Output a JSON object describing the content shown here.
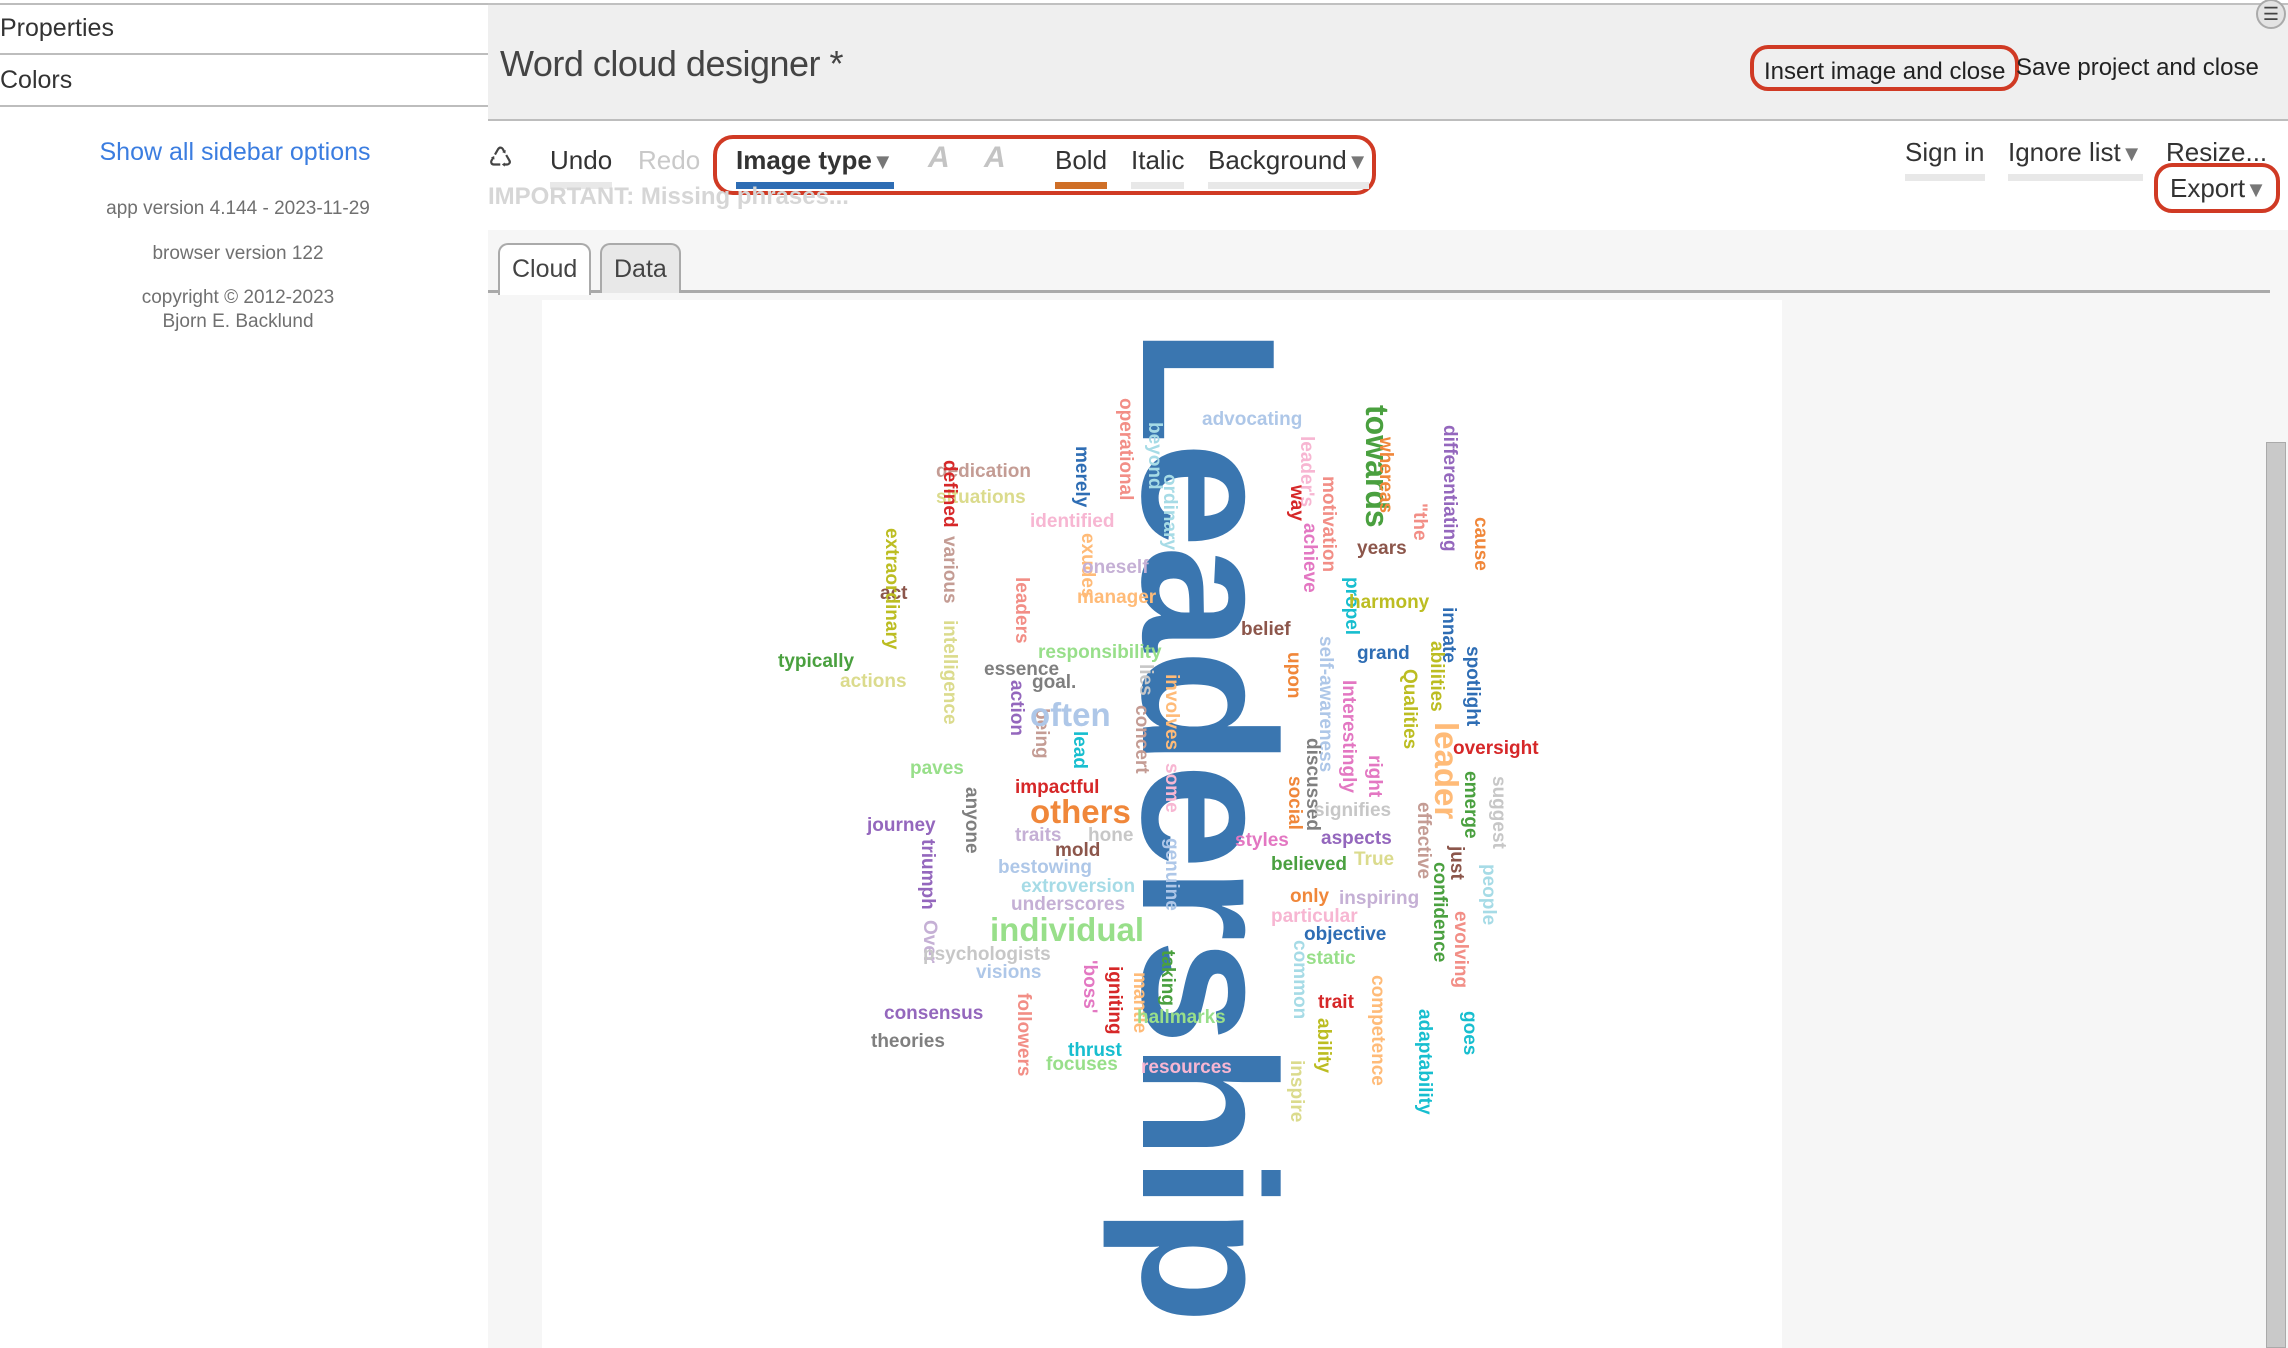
{
  "sidebar": {
    "items": [
      {
        "label": "Properties"
      },
      {
        "label": "Colors"
      }
    ],
    "show_all_link": "Show all sidebar options",
    "app_version": "app version 4.144 - 2023-11-29",
    "browser_version": "browser version 122",
    "copyright_line1": "copyright © 2012-2023",
    "copyright_line2": "Bjorn E. Backlund"
  },
  "header": {
    "title": "Word cloud designer *",
    "insert_button": "Insert image and close",
    "save_button": "Save project and close",
    "menu_icon": "☰"
  },
  "toolbar": {
    "recycle_icon": "♺",
    "undo": "Undo",
    "redo": "Redo",
    "image_type": "Image type",
    "font_decrease_icon": "A",
    "font_increase_icon": "A",
    "bold": "Bold",
    "italic": "Italic",
    "background": "Background",
    "sign_in": "Sign in",
    "ignore_list": "Ignore list",
    "resize": "Resize...",
    "export": "Export",
    "dropdown_arrow": "▼",
    "important_notice": "IMPORTANT: Missing phrases..."
  },
  "tabs": [
    {
      "label": "Cloud",
      "active": true
    },
    {
      "label": "Data",
      "active": false
    }
  ],
  "highlight_color": "#d03a24",
  "word_cloud": {
    "main_word": {
      "text": "Leadership",
      "color": "#3a76b0"
    },
    "words": [
      {
        "text": "advocating",
        "color": "#aec7e8"
      },
      {
        "text": "towards",
        "color": "#4aa03f"
      },
      {
        "text": "operational",
        "color": "#f28e86"
      },
      {
        "text": "beyond",
        "color": "#a6dbe6"
      },
      {
        "text": "ordinary",
        "color": "#a6dbe6"
      },
      {
        "text": "merely",
        "color": "#2e6db4"
      },
      {
        "text": "dedication",
        "color": "#c49c94"
      },
      {
        "text": "situations",
        "color": "#dbdb8d"
      },
      {
        "text": "defined",
        "color": "#d62728"
      },
      {
        "text": "identified",
        "color": "#f7b6d2"
      },
      {
        "text": "exudes",
        "color": "#ffbb78"
      },
      {
        "text": "oneself",
        "color": "#c5b0d5"
      },
      {
        "text": "manager",
        "color": "#ffbb78"
      },
      {
        "text": "various",
        "color": "#c49c94"
      },
      {
        "text": "act",
        "color": "#8c564b"
      },
      {
        "text": "extraordinary",
        "color": "#bcbd22"
      },
      {
        "text": "leaders",
        "color": "#f28e86"
      },
      {
        "text": "intelligence",
        "color": "#dbdb8d"
      },
      {
        "text": "typically",
        "color": "#4aa03f"
      },
      {
        "text": "actions",
        "color": "#dbdb8d"
      },
      {
        "text": "responsibility",
        "color": "#98df8a"
      },
      {
        "text": "essence",
        "color": "#7f7f7f"
      },
      {
        "text": "goal.",
        "color": "#7f7f7f"
      },
      {
        "text": "lies",
        "color": "#c7c7c7"
      },
      {
        "text": "involves",
        "color": "#ffbb78"
      },
      {
        "text": "action",
        "color": "#9467bd"
      },
      {
        "text": "being",
        "color": "#c49c94"
      },
      {
        "text": "often",
        "color": "#aec7e8"
      },
      {
        "text": "lead",
        "color": "#17becf"
      },
      {
        "text": "concert",
        "color": "#c49c94"
      },
      {
        "text": "some",
        "color": "#f7b6d2"
      },
      {
        "text": "paves",
        "color": "#98df8a"
      },
      {
        "text": "anyone",
        "color": "#7f7f7f"
      },
      {
        "text": "impactful",
        "color": "#d62728"
      },
      {
        "text": "others",
        "color": "#f0873a"
      },
      {
        "text": "journey",
        "color": "#9467bd"
      },
      {
        "text": "triumph",
        "color": "#9467bd"
      },
      {
        "text": "traits",
        "color": "#c5b0d5"
      },
      {
        "text": "hone",
        "color": "#c7c7c7"
      },
      {
        "text": "mold",
        "color": "#8c564b"
      },
      {
        "text": "genuine",
        "color": "#aec7e8"
      },
      {
        "text": "bestowing",
        "color": "#aec7e8"
      },
      {
        "text": "extroversion",
        "color": "#a6dbe6"
      },
      {
        "text": "underscores",
        "color": "#c5b0d5"
      },
      {
        "text": "individual",
        "color": "#98df8a"
      },
      {
        "text": "Over",
        "color": "#c5b0d5"
      },
      {
        "text": "psychologists",
        "color": "#c7c7c7"
      },
      {
        "text": "visions",
        "color": "#aec7e8"
      },
      {
        "text": "'boss'",
        "color": "#e377c2"
      },
      {
        "text": "igniting",
        "color": "#d62728"
      },
      {
        "text": "mantle",
        "color": "#ffbb78"
      },
      {
        "text": "taking",
        "color": "#4aa03f"
      },
      {
        "text": "consensus",
        "color": "#9467bd"
      },
      {
        "text": "followers",
        "color": "#f28e86"
      },
      {
        "text": "hallmarks",
        "color": "#98df8a"
      },
      {
        "text": "theories",
        "color": "#7f7f7f"
      },
      {
        "text": "thrust",
        "color": "#17becf"
      },
      {
        "text": "focuses",
        "color": "#98df8a"
      },
      {
        "text": "resources",
        "color": "#f7b6d2"
      },
      {
        "text": "leader's",
        "color": "#f7b6d2"
      },
      {
        "text": "way",
        "color": "#d62728"
      },
      {
        "text": "motivation",
        "color": "#f28e86"
      },
      {
        "text": "achieve",
        "color": "#e377c2"
      },
      {
        "text": "whereas",
        "color": "#f0873a"
      },
      {
        "text": "\"the",
        "color": "#f28e86"
      },
      {
        "text": "years",
        "color": "#8c564b"
      },
      {
        "text": "differentiating",
        "color": "#9467bd"
      },
      {
        "text": "cause",
        "color": "#f0873a"
      },
      {
        "text": "propel",
        "color": "#17becf"
      },
      {
        "text": "harmony",
        "color": "#bcbd22"
      },
      {
        "text": "belief",
        "color": "#8c564b"
      },
      {
        "text": "innate",
        "color": "#2e6db4"
      },
      {
        "text": "grand",
        "color": "#2e6db4"
      },
      {
        "text": "abilities",
        "color": "#bcbd22"
      },
      {
        "text": "spotlight",
        "color": "#2e6db4"
      },
      {
        "text": "upon",
        "color": "#f0873a"
      },
      {
        "text": "self-awareness",
        "color": "#aec7e8"
      },
      {
        "text": "Interestingly",
        "color": "#e377c2"
      },
      {
        "text": "Qualities",
        "color": "#bcbd22"
      },
      {
        "text": "leader",
        "color": "#ffbb78"
      },
      {
        "text": "oversight",
        "color": "#d62728"
      },
      {
        "text": "discussed",
        "color": "#7f7f7f"
      },
      {
        "text": "right",
        "color": "#e377c2"
      },
      {
        "text": "emerge",
        "color": "#4aa03f"
      },
      {
        "text": "suggest",
        "color": "#c7c7c7"
      },
      {
        "text": "social",
        "color": "#f0873a"
      },
      {
        "text": "signifies",
        "color": "#c7c7c7"
      },
      {
        "text": "effective",
        "color": "#c49c94"
      },
      {
        "text": "styles",
        "color": "#e377c2"
      },
      {
        "text": "aspects",
        "color": "#9467bd"
      },
      {
        "text": "just",
        "color": "#8c564b"
      },
      {
        "text": "believed",
        "color": "#4aa03f"
      },
      {
        "text": "True",
        "color": "#dbdb8d"
      },
      {
        "text": "confidence",
        "color": "#4aa03f"
      },
      {
        "text": "people",
        "color": "#a6dbe6"
      },
      {
        "text": "only",
        "color": "#f0873a"
      },
      {
        "text": "inspiring",
        "color": "#c5b0d5"
      },
      {
        "text": "evolving",
        "color": "#f28e86"
      },
      {
        "text": "particular",
        "color": "#f7b6d2"
      },
      {
        "text": "objective",
        "color": "#2e6db4"
      },
      {
        "text": "common",
        "color": "#a6dbe6"
      },
      {
        "text": "static",
        "color": "#98df8a"
      },
      {
        "text": "trait",
        "color": "#d62728"
      },
      {
        "text": "competence",
        "color": "#ffbb78"
      },
      {
        "text": "ability",
        "color": "#bcbd22"
      },
      {
        "text": "adaptability",
        "color": "#17becf"
      },
      {
        "text": "goes",
        "color": "#17becf"
      },
      {
        "text": "inspire",
        "color": "#dbdb8d"
      }
    ]
  }
}
